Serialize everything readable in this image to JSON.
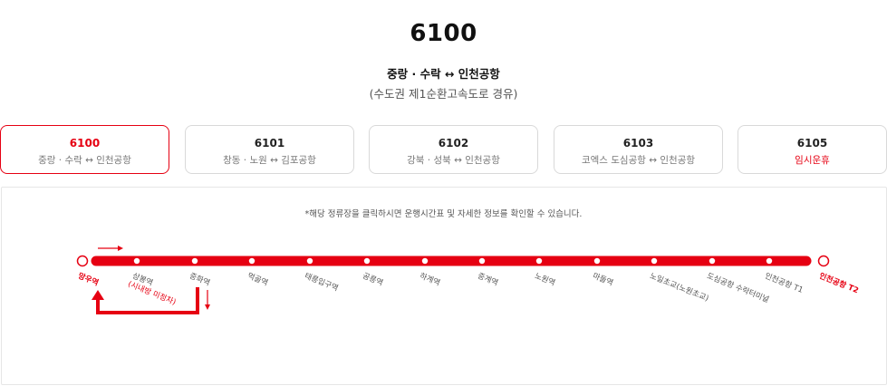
{
  "header": {
    "title": "6100",
    "route": "중랑 · 수락 ↔ 인천공항",
    "via": "(수도권 제1순환고속도로 경유)"
  },
  "tabs": [
    {
      "number": "6100",
      "desc": "중랑 · 수락 ↔ 인천공항",
      "active": true
    },
    {
      "number": "6101",
      "desc": "창동 · 노원 ↔ 김포공항",
      "active": false
    },
    {
      "number": "6102",
      "desc": "강북 · 성북 ↔ 인천공항",
      "active": false
    },
    {
      "number": "6103",
      "desc": "코엑스 도심공항 ↔ 인천공항",
      "active": false
    },
    {
      "number": "6105",
      "desc": "임시운휴",
      "active": false,
      "desc_red": true
    }
  ],
  "notice": "*해당 정류장을 클릭하시면 운행시간표 및 자세한 정보를 확인할 수 있습니다.",
  "stations": [
    {
      "name": "망우역",
      "type": "terminal"
    },
    {
      "name": "상봉역",
      "sub": "(시내방 미정차)"
    },
    {
      "name": "중화역"
    },
    {
      "name": "먹골역"
    },
    {
      "name": "태릉입구역"
    },
    {
      "name": "공릉역"
    },
    {
      "name": "하계역"
    },
    {
      "name": "중계역"
    },
    {
      "name": "노원역"
    },
    {
      "name": "마들역"
    },
    {
      "name": "노일초교(노원초교)"
    },
    {
      "name": "도심공항 수락터미널"
    },
    {
      "name": "인천공항 T1"
    },
    {
      "name": "인천공항 T2",
      "type": "terminal"
    }
  ],
  "colors": {
    "accent": "#e60012",
    "border": "#d9d9d9",
    "text_gray": "#777777"
  }
}
